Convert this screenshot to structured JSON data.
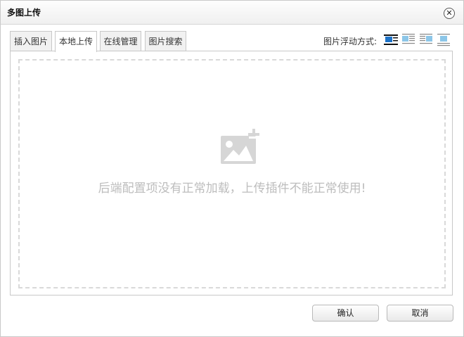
{
  "dialog": {
    "title": "多图上传",
    "close_icon": "close-icon"
  },
  "tabs": [
    {
      "label": "插入图片",
      "active": false
    },
    {
      "label": "本地上传",
      "active": true
    },
    {
      "label": "在线管理",
      "active": false
    },
    {
      "label": "图片搜索",
      "active": false
    }
  ],
  "float": {
    "label": "图片浮动方式:",
    "options": [
      "float-none-icon",
      "float-left-icon",
      "float-right-icon",
      "float-center-icon"
    ],
    "selected_index": 0
  },
  "upload": {
    "placeholder_icon": "image-add-icon",
    "error_message": "后端配置项没有正常加载，上传插件不能正常使用!"
  },
  "buttons": {
    "confirm": "确认",
    "cancel": "取消"
  },
  "colors": {
    "accent_blue": "#1e73c8",
    "light_blue": "#8cc6e8",
    "muted_text": "#bdbdbd"
  }
}
